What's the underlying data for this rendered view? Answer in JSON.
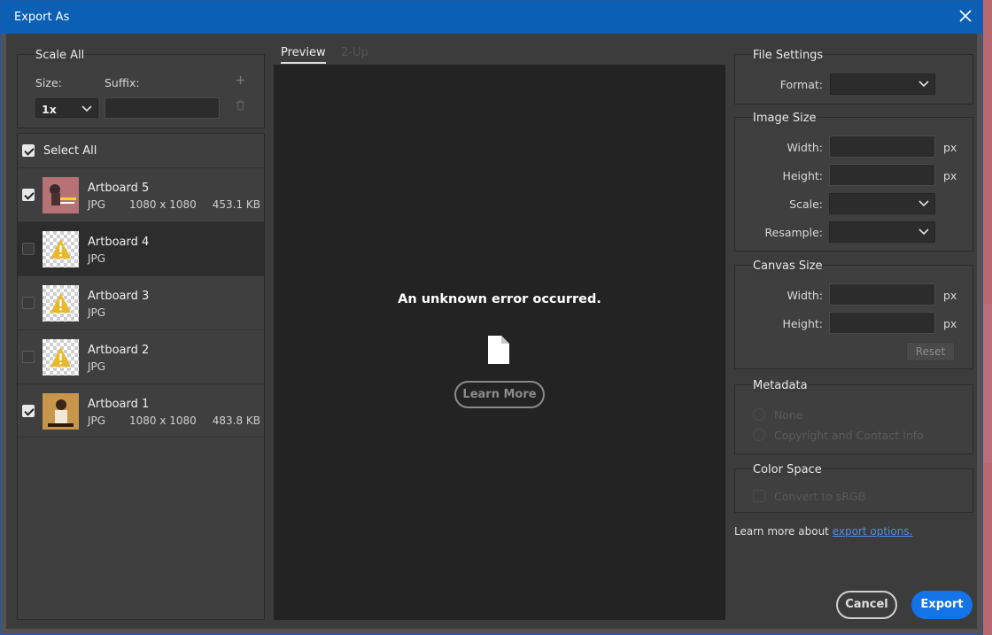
{
  "window": {
    "title": "Export As"
  },
  "scale_all": {
    "legend": "Scale All",
    "size_label": "Size:",
    "suffix_label": "Suffix:",
    "size_value": "1x",
    "suffix_value": "",
    "add_icon": "plus-icon",
    "delete_icon": "trash-icon"
  },
  "artboards": {
    "select_all_label": "Select All",
    "select_all_checked": true,
    "items": [
      {
        "name": "Artboard 5",
        "format": "JPG",
        "dimensions": "1080 x 1080",
        "size": "453.1 KB",
        "checked": true
      },
      {
        "name": "Artboard 4",
        "format": "JPG",
        "dimensions": "",
        "size": "",
        "checked": false
      },
      {
        "name": "Artboard 3",
        "format": "JPG",
        "dimensions": "",
        "size": "",
        "checked": false
      },
      {
        "name": "Artboard 2",
        "format": "JPG",
        "dimensions": "",
        "size": "",
        "checked": false
      },
      {
        "name": "Artboard 1",
        "format": "JPG",
        "dimensions": "1080 x 1080",
        "size": "483.8 KB",
        "checked": true
      }
    ]
  },
  "preview": {
    "tab_preview": "Preview",
    "tab_other": "2-Up",
    "error_text": "An unknown error occurred.",
    "learn_more_button": "Learn More"
  },
  "file_settings": {
    "legend": "File Settings",
    "format_label": "Format:",
    "format_value": ""
  },
  "image_size": {
    "legend": "Image Size",
    "width_label": "Width:",
    "width_value": "",
    "width_unit": "px",
    "height_label": "Height:",
    "height_value": "",
    "height_unit": "px",
    "scale_label": "Scale:",
    "scale_value": "",
    "resample_label": "Resample:",
    "resample_value": ""
  },
  "canvas_size": {
    "legend": "Canvas Size",
    "width_label": "Width:",
    "width_value": "",
    "width_unit": "px",
    "height_label": "Height:",
    "height_value": "",
    "height_unit": "px",
    "reset_button": "Reset"
  },
  "metadata": {
    "legend": "Metadata",
    "option_none": "None",
    "option_copyright": "Copyright and Contact Info"
  },
  "color_space": {
    "legend": "Color Space",
    "convert_label": "Convert to sRGB"
  },
  "footer": {
    "learn_more_prefix": "Learn more about ",
    "learn_more_link": "export options.",
    "cancel_button": "Cancel",
    "export_button": "Export"
  },
  "colors": {
    "title_bar": "#0b5fb4",
    "export_button": "#1473e6",
    "link": "#4f8fe8",
    "warning": "#e8b92a"
  }
}
